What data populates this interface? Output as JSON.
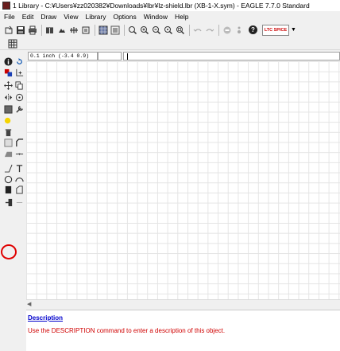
{
  "window": {
    "title": "1 Library - C:¥Users¥zz020382¥Downloads¥lbr¥lz-shield.lbr (XB-1-X.sym) - EAGLE 7.7.0 Standard"
  },
  "menu": [
    {
      "label": "File"
    },
    {
      "label": "Edit"
    },
    {
      "label": "Draw"
    },
    {
      "label": "View"
    },
    {
      "label": "Library"
    },
    {
      "label": "Options"
    },
    {
      "label": "Window"
    },
    {
      "label": "Help"
    }
  ],
  "toolbar": {
    "help_label": "?",
    "spice_label": "LTC SPICE"
  },
  "coords": {
    "value": "0.1 inch (-3.4 0.9)"
  },
  "description": {
    "link": "Description",
    "text": "Use the DESCRIPTION command to enter a description of this object."
  },
  "colors": {
    "highlight": "#e00000",
    "description_link": "#0000cc",
    "description_text": "#d00000"
  }
}
